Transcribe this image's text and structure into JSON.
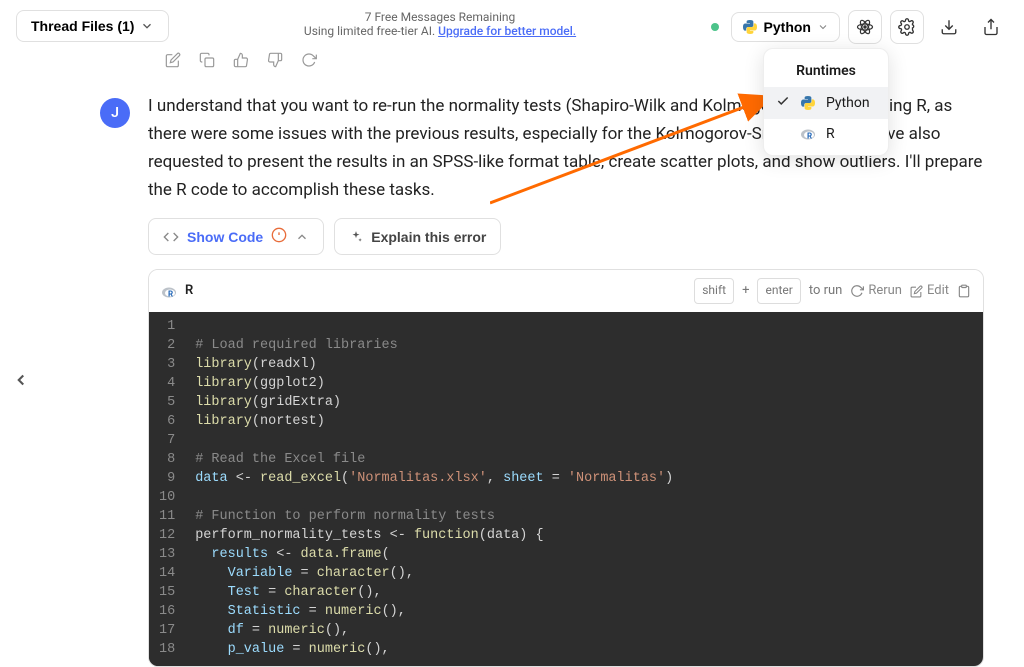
{
  "topbar": {
    "thread_files_label": "Thread Files (1)",
    "free_messages": "7 Free Messages Remaining",
    "free_tier_note": "Using limited free-tier AI. ",
    "upgrade_text": "Upgrade for better model.",
    "runtime_label": "Python"
  },
  "dropdown": {
    "header": "Runtimes",
    "items": [
      {
        "label": "Python",
        "selected": true
      },
      {
        "label": "R",
        "selected": false
      }
    ]
  },
  "avatar_letter": "J",
  "message_text": "I understand that you want to re-run the normality tests (Shapiro-Wilk and Kolmogorov-Smirnov) using R, as there were some issues with the previous results, especially for the Kolmogorov-Smirnov test. You've also requested to present the results in an SPSS-like format table, create scatter plots, and show outliers. I'll prepare the R code to accomplish these tasks.",
  "action_btns": {
    "show_code_label": "Show Code",
    "explain_error_label": "Explain this error"
  },
  "code_header": {
    "lang": "R",
    "shift": "shift",
    "plus": "+",
    "enter": "enter",
    "to_run": "to run",
    "rerun": "Rerun",
    "edit": "Edit"
  },
  "code_lines": [
    "",
    "# Load required libraries",
    "library(readxl)",
    "library(ggplot2)",
    "library(gridExtra)",
    "library(nortest)",
    "",
    "# Read the Excel file",
    "data <- read_excel('Normalitas.xlsx', sheet = 'Normalitas')",
    "",
    "# Function to perform normality tests",
    "perform_normality_tests <- function(data) {",
    "  results <- data.frame(",
    "    Variable = character(),",
    "    Test = character(),",
    "    Statistic = numeric(),",
    "    df = numeric(),",
    "    p_value = numeric(),"
  ]
}
